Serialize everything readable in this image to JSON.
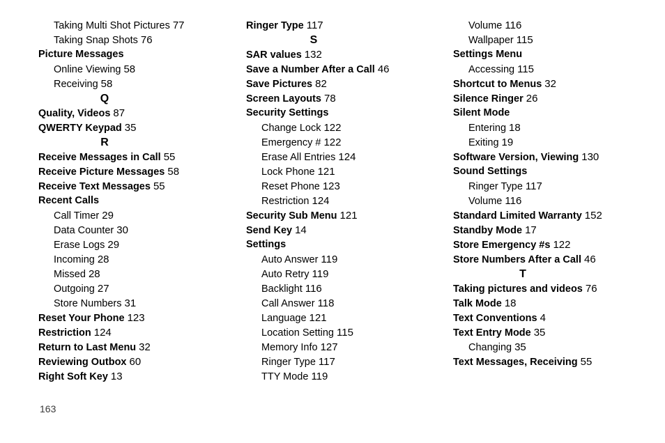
{
  "page": {
    "number": "163",
    "type": "index"
  },
  "columns": [
    {
      "id": "column-1",
      "entries": [
        {
          "kind": "entry",
          "level": 1,
          "title": "Taking Multi Shot Pictures",
          "page": "77"
        },
        {
          "kind": "entry",
          "level": 1,
          "title": "Taking Snap Shots",
          "page": "76"
        },
        {
          "kind": "entry",
          "level": 0,
          "title": "Picture Messages",
          "page": ""
        },
        {
          "kind": "entry",
          "level": 1,
          "title": "Online Viewing",
          "page": "58"
        },
        {
          "kind": "entry",
          "level": 1,
          "title": "Receiving",
          "page": "58"
        },
        {
          "kind": "letter",
          "letter": "Q"
        },
        {
          "kind": "entry",
          "level": 0,
          "title": "Quality, Videos",
          "page": "87"
        },
        {
          "kind": "entry",
          "level": 0,
          "title": "QWERTY Keypad",
          "page": "35"
        },
        {
          "kind": "letter",
          "letter": "R"
        },
        {
          "kind": "entry",
          "level": 0,
          "title": "Receive Messages in Call",
          "page": "55"
        },
        {
          "kind": "entry",
          "level": 0,
          "title": "Receive Picture Messages",
          "page": "58"
        },
        {
          "kind": "entry",
          "level": 0,
          "title": "Receive Text Messages",
          "page": "55"
        },
        {
          "kind": "entry",
          "level": 0,
          "title": "Recent Calls",
          "page": ""
        },
        {
          "kind": "entry",
          "level": 1,
          "title": "Call Timer",
          "page": "29"
        },
        {
          "kind": "entry",
          "level": 1,
          "title": "Data Counter",
          "page": "30"
        },
        {
          "kind": "entry",
          "level": 1,
          "title": "Erase Logs",
          "page": "29"
        },
        {
          "kind": "entry",
          "level": 1,
          "title": "Incoming",
          "page": "28"
        },
        {
          "kind": "entry",
          "level": 1,
          "title": "Missed",
          "page": "28"
        },
        {
          "kind": "entry",
          "level": 1,
          "title": "Outgoing",
          "page": "27"
        },
        {
          "kind": "entry",
          "level": 1,
          "title": "Store Numbers",
          "page": "31"
        },
        {
          "kind": "entry",
          "level": 0,
          "title": "Reset Your Phone",
          "page": "123"
        },
        {
          "kind": "entry",
          "level": 0,
          "title": "Restriction",
          "page": "124"
        },
        {
          "kind": "entry",
          "level": 0,
          "title": "Return to Last Menu",
          "page": "32"
        },
        {
          "kind": "entry",
          "level": 0,
          "title": "Reviewing Outbox",
          "page": "60"
        },
        {
          "kind": "entry",
          "level": 0,
          "title": "Right Soft Key",
          "page": "13"
        }
      ]
    },
    {
      "id": "column-2",
      "entries": [
        {
          "kind": "entry",
          "level": 0,
          "title": "Ringer Type",
          "page": "117"
        },
        {
          "kind": "letter",
          "letter": "S"
        },
        {
          "kind": "entry",
          "level": 0,
          "title": "SAR values",
          "page": "132"
        },
        {
          "kind": "entry",
          "level": 0,
          "title": "Save a Number After a Call",
          "page": "46"
        },
        {
          "kind": "entry",
          "level": 0,
          "title": "Save Pictures",
          "page": "82"
        },
        {
          "kind": "entry",
          "level": 0,
          "title": "Screen Layouts",
          "page": "78"
        },
        {
          "kind": "entry",
          "level": 0,
          "title": "Security Settings",
          "page": ""
        },
        {
          "kind": "entry",
          "level": 1,
          "title": "Change Lock",
          "page": "122"
        },
        {
          "kind": "entry",
          "level": 1,
          "title": "Emergency #",
          "page": "122"
        },
        {
          "kind": "entry",
          "level": 1,
          "title": "Erase All Entries",
          "page": "124"
        },
        {
          "kind": "entry",
          "level": 1,
          "title": "Lock Phone",
          "page": "121"
        },
        {
          "kind": "entry",
          "level": 1,
          "title": "Reset Phone",
          "page": "123"
        },
        {
          "kind": "entry",
          "level": 1,
          "title": "Restriction",
          "page": "124"
        },
        {
          "kind": "entry",
          "level": 0,
          "title": "Security Sub Menu",
          "page": "121"
        },
        {
          "kind": "entry",
          "level": 0,
          "title": "Send Key",
          "page": "14"
        },
        {
          "kind": "entry",
          "level": 0,
          "title": "Settings",
          "page": ""
        },
        {
          "kind": "entry",
          "level": 1,
          "title": "Auto Answer",
          "page": "119"
        },
        {
          "kind": "entry",
          "level": 1,
          "title": "Auto Retry",
          "page": "119"
        },
        {
          "kind": "entry",
          "level": 1,
          "title": "Backlight",
          "page": "116"
        },
        {
          "kind": "entry",
          "level": 1,
          "title": "Call Answer",
          "page": "118"
        },
        {
          "kind": "entry",
          "level": 1,
          "title": "Language",
          "page": "121"
        },
        {
          "kind": "entry",
          "level": 1,
          "title": "Location Setting",
          "page": "115"
        },
        {
          "kind": "entry",
          "level": 1,
          "title": "Memory Info",
          "page": "127"
        },
        {
          "kind": "entry",
          "level": 1,
          "title": "Ringer Type",
          "page": "117"
        },
        {
          "kind": "entry",
          "level": 1,
          "title": "TTY Mode",
          "page": "119"
        }
      ]
    },
    {
      "id": "column-3",
      "entries": [
        {
          "kind": "entry",
          "level": 1,
          "title": "Volume",
          "page": "116"
        },
        {
          "kind": "entry",
          "level": 1,
          "title": "Wallpaper",
          "page": "115"
        },
        {
          "kind": "entry",
          "level": 0,
          "title": "Settings Menu",
          "page": ""
        },
        {
          "kind": "entry",
          "level": 1,
          "title": "Accessing",
          "page": "115"
        },
        {
          "kind": "entry",
          "level": 0,
          "title": "Shortcut to Menus",
          "page": "32"
        },
        {
          "kind": "entry",
          "level": 0,
          "title": "Silence Ringer",
          "page": "26"
        },
        {
          "kind": "entry",
          "level": 0,
          "title": "Silent Mode",
          "page": ""
        },
        {
          "kind": "entry",
          "level": 1,
          "title": "Entering",
          "page": "18"
        },
        {
          "kind": "entry",
          "level": 1,
          "title": "Exiting",
          "page": "19"
        },
        {
          "kind": "entry",
          "level": 0,
          "title": "Software Version, Viewing",
          "page": "130"
        },
        {
          "kind": "entry",
          "level": 0,
          "title": "Sound Settings",
          "page": ""
        },
        {
          "kind": "entry",
          "level": 1,
          "title": "Ringer Type",
          "page": "117"
        },
        {
          "kind": "entry",
          "level": 1,
          "title": "Volume",
          "page": "116"
        },
        {
          "kind": "entry",
          "level": 0,
          "title": "Standard Limited Warranty",
          "page": "152"
        },
        {
          "kind": "entry",
          "level": 0,
          "title": "Standby Mode",
          "page": "17"
        },
        {
          "kind": "entry",
          "level": 0,
          "title": "Store Emergency #s",
          "page": "122"
        },
        {
          "kind": "entry",
          "level": 0,
          "title": "Store Numbers After a Call",
          "page": "46"
        },
        {
          "kind": "letter",
          "letter": "T"
        },
        {
          "kind": "entry",
          "level": 0,
          "title": "Taking pictures and videos",
          "page": "76"
        },
        {
          "kind": "entry",
          "level": 0,
          "title": "Talk Mode",
          "page": "18"
        },
        {
          "kind": "entry",
          "level": 0,
          "title": "Text Conventions",
          "page": "4"
        },
        {
          "kind": "entry",
          "level": 0,
          "title": "Text Entry Mode",
          "page": "35"
        },
        {
          "kind": "entry",
          "level": 1,
          "title": "Changing",
          "page": "35"
        },
        {
          "kind": "entry",
          "level": 0,
          "title": "Text Messages, Receiving",
          "page": "55"
        }
      ]
    }
  ]
}
